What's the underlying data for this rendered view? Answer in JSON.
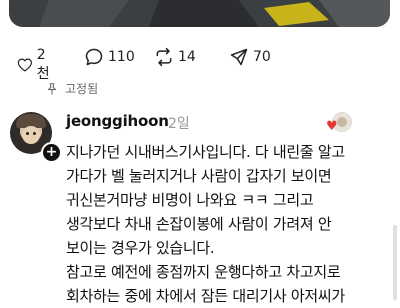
{
  "actions": [
    {
      "icon": "heart-icon",
      "count": "2천"
    },
    {
      "icon": "comment-icon",
      "count": "110"
    },
    {
      "icon": "repost-icon",
      "count": "14"
    },
    {
      "icon": "share-icon",
      "count": "70"
    }
  ],
  "pinned_label": "고정됨",
  "comment": {
    "username": "jeonggihoon",
    "time": "2일",
    "lines": [
      "지나가던 시내버스기사입니다. 다 내린줄 알고",
      "가다가 벨 눌러지거나 사람이 갑자기 보이면",
      "귀신본거마냥 비명이 나와요 ㅋㅋ 그리고",
      "생각보다 차내 손잡이봉에 사람이 가려져 안",
      "보이는 경우가 있습니다.",
      "참고로 예전에 종점까지 운행다하고 차고지로",
      "회차하는 중에 차에서 잠든 대리기사 아저씨가"
    ]
  },
  "colors": {
    "accent_heart": "#e53935",
    "text": "#111111",
    "muted": "#999999"
  }
}
